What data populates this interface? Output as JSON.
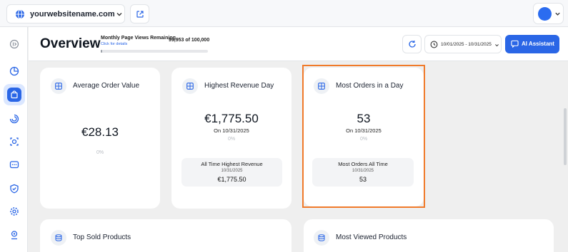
{
  "topbar": {
    "site_name": "yourwebsitename.com"
  },
  "header": {
    "title": "Overview",
    "page_views_label": "Monthly Page Views Remaining",
    "page_views_count": "99,953 of 100,000",
    "page_views_link": "Click for details",
    "page_views_fraction": 0.00047,
    "date_range": "10/01/2025 - 10/31/2025",
    "ai_label": "AI Assistant"
  },
  "cards": {
    "avg_order": {
      "title": "Average Order Value",
      "value": "€28.13",
      "pct": "0%"
    },
    "highest_revenue": {
      "title": "Highest Revenue Day",
      "value": "€1,775.50",
      "date": "On 10/31/2025",
      "pct": "0%",
      "all_time_label": "All Time Highest Revenue",
      "all_time_date": "10/31/2025",
      "all_time_value": "€1,775.50"
    },
    "most_orders": {
      "title": "Most Orders in a Day",
      "value": "53",
      "date": "On 10/31/2025",
      "pct": "0%",
      "all_time_label": "Most Orders All Time",
      "all_time_date": "10/31/2025",
      "all_time_value": "53"
    },
    "top_sold": {
      "title": "Top Sold Products"
    },
    "most_viewed": {
      "title": "Most Viewed Products"
    }
  },
  "colors": {
    "accent": "#2a66e6",
    "highlight": "#f07a2a"
  },
  "sidebar": {
    "items": [
      "collapse-icon",
      "chart-pie-icon",
      "shopping-bag-icon",
      "activity-icon",
      "target-icon",
      "chat-icon",
      "shield-icon",
      "gear-icon",
      "user-pin-icon"
    ]
  }
}
